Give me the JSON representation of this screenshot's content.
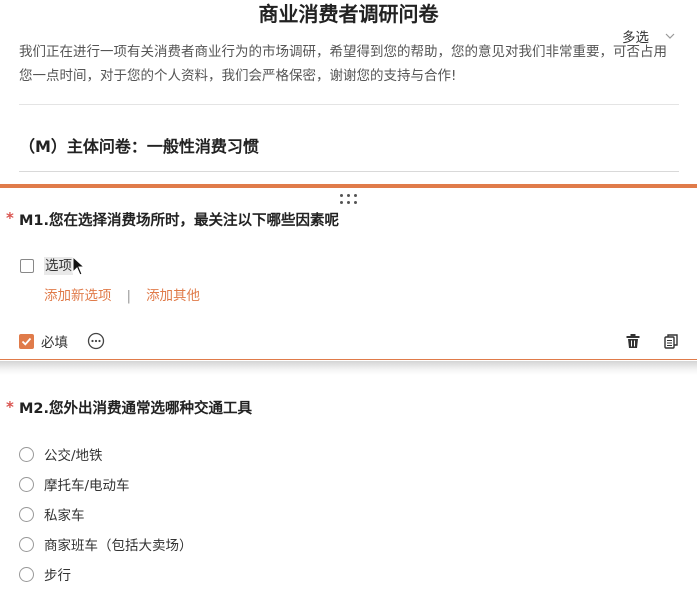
{
  "survey": {
    "title": "商业消费者调研问卷",
    "description": "我们正在进行一项有关消费者商业行为的市场调研，希望得到您的帮助，您的意见对我们非常重要，可否占用您一点时间，对于您的个人资料，我们会严格保密，谢谢您的支持与合作!"
  },
  "section": {
    "title": "（M）主体问卷：一般性消费习惯"
  },
  "question1": {
    "required_mark": "*",
    "title": "M1.您在选择消费场所时，最关注以下哪些因素呢",
    "type_label": "多选",
    "option_label": "选项",
    "add_option_label": "添加新选项",
    "separator": "|",
    "add_other_label": "添加其他",
    "required_label": "必填"
  },
  "question2": {
    "required_mark": "*",
    "title": "M2.您外出消费通常选哪种交通工具",
    "options": [
      "公交/地铁",
      "摩托车/电动车",
      "私家车",
      "商家班车（包括大卖场）",
      "步行"
    ]
  },
  "colors": {
    "accent": "#e07b4a",
    "required": "#d9534f"
  },
  "icons": [
    "drag-handle-icon",
    "chevron-down-icon",
    "mouse-cursor-icon",
    "check-icon",
    "more-icon",
    "trash-icon",
    "copy-icon"
  ]
}
